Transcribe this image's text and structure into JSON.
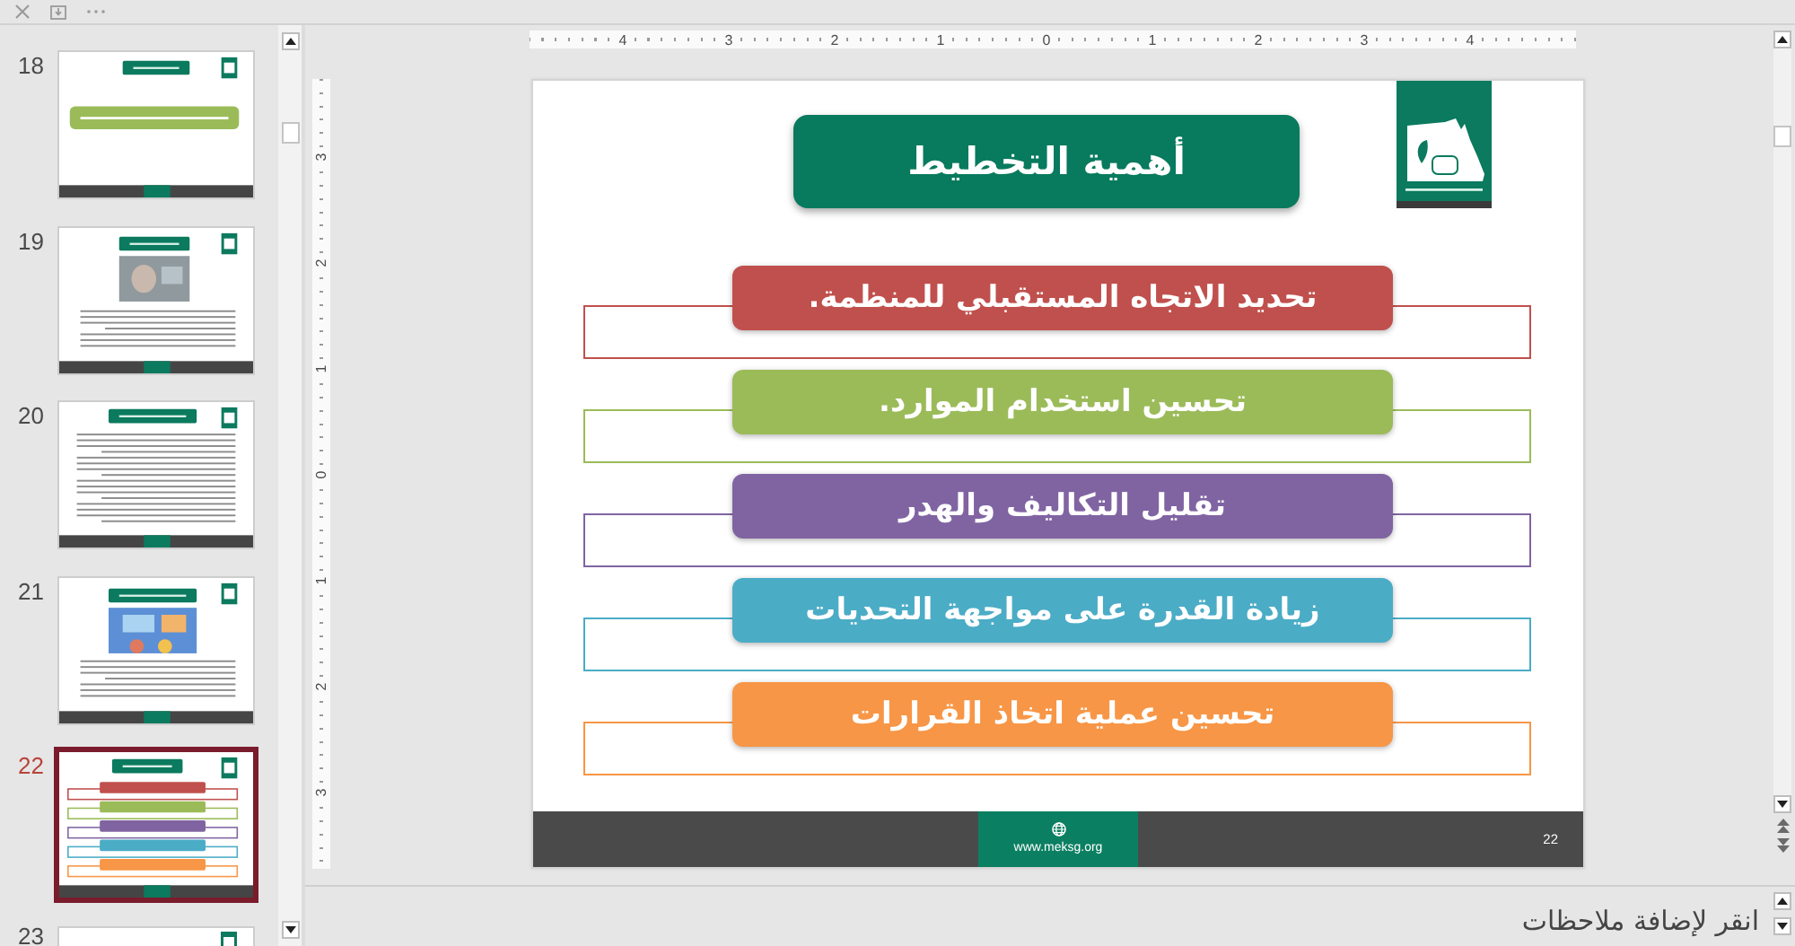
{
  "thumbnails": [
    {
      "number": "18",
      "kind": "banner",
      "selected": false
    },
    {
      "number": "19",
      "kind": "photo",
      "selected": false
    },
    {
      "number": "20",
      "kind": "text",
      "selected": false
    },
    {
      "number": "21",
      "kind": "illustration",
      "selected": false
    },
    {
      "number": "22",
      "kind": "list",
      "selected": true
    },
    {
      "number": "23",
      "kind": "cut",
      "selected": false
    }
  ],
  "ruler": {
    "horizontal": [
      "4",
      "3",
      "2",
      "1",
      "0",
      "1",
      "2",
      "3",
      "4"
    ],
    "vertical": [
      "3",
      "2",
      "1",
      "0",
      "1",
      "2",
      "3"
    ]
  },
  "slide": {
    "title": "أهمية التخطيط",
    "points": [
      {
        "text": "تحديد الاتجاه المستقبلي للمنظمة.",
        "color": "#c0504d"
      },
      {
        "text": "تحسين استخدام الموارد.",
        "color": "#9bbb59"
      },
      {
        "text": "تقليل التكاليف والهدر",
        "color": "#8064a2"
      },
      {
        "text": "زيادة القدرة على مواجهة التحديات",
        "color": "#4bacc6"
      },
      {
        "text": "تحسين عملية اتخاذ القرارات",
        "color": "#f79646"
      }
    ],
    "footer": {
      "website": "www.meksg.org",
      "slide_number": "22"
    }
  },
  "notes": {
    "placeholder": "انقر لإضافة ملاحظات"
  }
}
